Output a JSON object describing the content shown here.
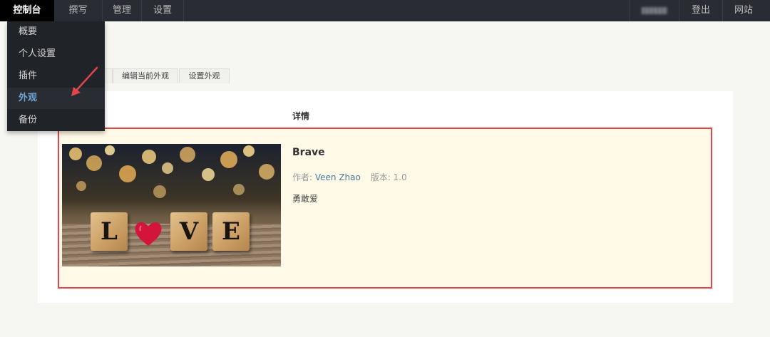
{
  "navbar": {
    "items": [
      {
        "label": "控制台",
        "active": true
      },
      {
        "label": "撰写"
      },
      {
        "label": "管理"
      },
      {
        "label": "设置"
      }
    ],
    "right": {
      "logout": "登出",
      "site": "网站"
    }
  },
  "dropdown": {
    "items": [
      {
        "label": "概要"
      },
      {
        "label": "个人设置"
      },
      {
        "label": "插件"
      },
      {
        "label": "外观",
        "active": true
      },
      {
        "label": "备份"
      }
    ]
  },
  "tabs": [
    {
      "label": "编辑当前外观"
    },
    {
      "label": "设置外观"
    }
  ],
  "table": {
    "detail_header": "详情"
  },
  "theme": {
    "name": "Brave",
    "author_label": "作者:",
    "author_name": "Veen Zhao",
    "version_label": "版本:",
    "version": "1.0",
    "description": "勇敢爱",
    "screenshot": {
      "letters": [
        "L",
        "V",
        "E"
      ],
      "icon": "heart-icon"
    }
  },
  "colors": {
    "navbar_bg": "#292d33",
    "active_nav_bg": "#000000",
    "accent_link": "#467b96",
    "active_menu_text": "#6da1d3",
    "highlight_row_bg": "#fff9e8",
    "annotation_red": "#e2454a"
  }
}
